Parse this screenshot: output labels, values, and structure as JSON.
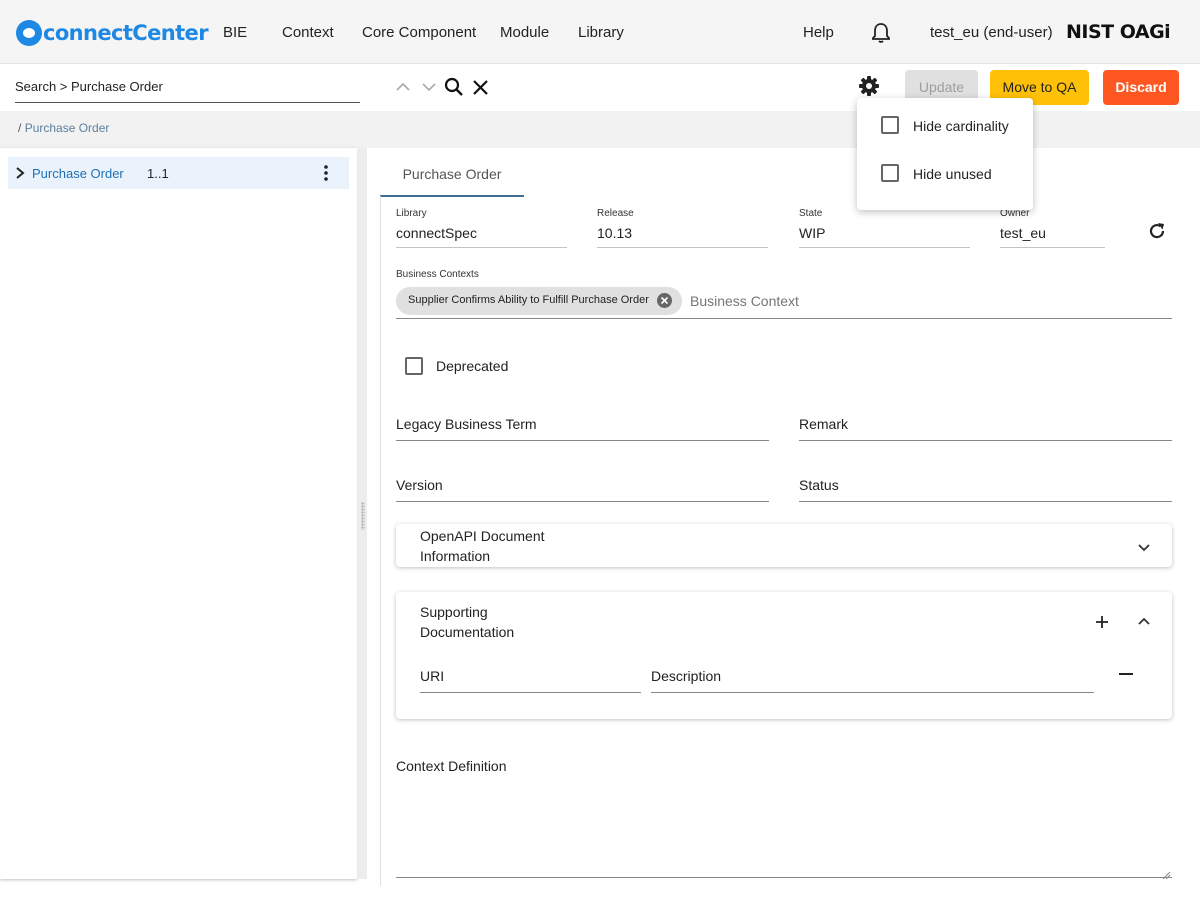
{
  "app": {
    "logo_text": "connectCenter"
  },
  "nav": {
    "items": [
      "BIE",
      "Context",
      "Core Component",
      "Module",
      "Library"
    ],
    "help": "Help",
    "user": "test_eu (end-user)",
    "org_logo": "NIST OAGi"
  },
  "search": {
    "value": "Search > Purchase Order"
  },
  "actions": {
    "update": "Update",
    "move_to_qa": "Move to QA",
    "discard": "Discard"
  },
  "settings_menu": {
    "items": [
      {
        "label": "Hide cardinality",
        "checked": false
      },
      {
        "label": "Hide unused",
        "checked": false
      }
    ]
  },
  "breadcrumb": {
    "separator": "/",
    "current": "Purchase Order"
  },
  "tree": {
    "node_label": "Purchase Order",
    "cardinality": "1..1"
  },
  "tabs": [
    {
      "label": "Purchase Order"
    }
  ],
  "details": {
    "library_label": "Library",
    "library": "connectSpec",
    "release_label": "Release",
    "release": "10.13",
    "state_label": "State",
    "state": "WIP",
    "owner_label": "Owner",
    "owner": "test_eu",
    "business_contexts_label": "Business Contexts",
    "business_context_chip": "Supplier Confirms Ability to Fulfill Purchase Order",
    "business_context_placeholder": "Business Context",
    "deprecated": {
      "label": "Deprecated",
      "checked": false
    },
    "legacy_business_term": "Legacy Business Term",
    "remark": "Remark",
    "version": "Version",
    "status": "Status",
    "openapi_title": "OpenAPI Document Information",
    "supporting_doc_title": "Supporting Documentation",
    "uri": "URI",
    "description": "Description",
    "context_definition": "Context Definition"
  },
  "colors": {
    "primary": "#1e88e5",
    "move_to_qa": "#ffc107",
    "discard": "#ff5722",
    "update_disabled": "#e0e0e0"
  }
}
